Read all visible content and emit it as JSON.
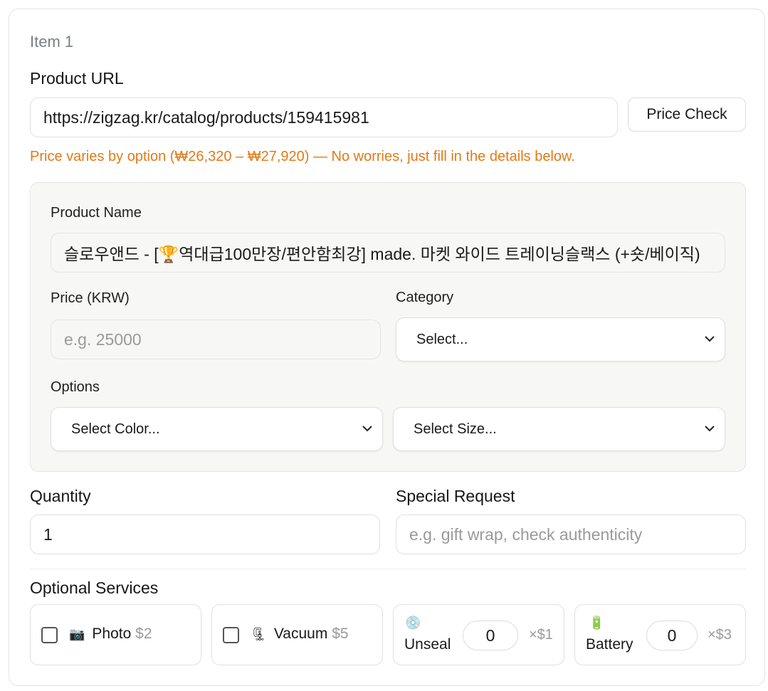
{
  "item": {
    "title": "Item 1"
  },
  "product_url": {
    "label": "Product URL",
    "value": "https://zigzag.kr/catalog/products/159415981",
    "price_check_button": "Price Check",
    "warning": "Price varies by option (₩26,320 – ₩27,920) — No worries, just fill in the details below."
  },
  "details": {
    "product_name_label": "Product Name",
    "product_name_value": "슬로우앤드 - [🏆역대급100만장/편안함최강] made. 마켓 와이드 트레이닝슬랙스 (+숏/베이직)",
    "price_label": "Price (KRW)",
    "price_placeholder": "e.g. 25000",
    "category_label": "Category",
    "category_value": "Select...",
    "options_label": "Options",
    "color_value": "Select Color...",
    "size_value": "Select Size..."
  },
  "quantity": {
    "label": "Quantity",
    "value": "1"
  },
  "special_request": {
    "label": "Special Request",
    "placeholder": "e.g. gift wrap, check authenticity"
  },
  "services": {
    "title": "Optional Services",
    "items": [
      {
        "icon": "camera-icon",
        "emoji": "📷",
        "name": "Photo",
        "price": "$2"
      },
      {
        "icon": "vacuum-icon",
        "emoji": "🗜",
        "name": "Vacuum",
        "price": "$5"
      },
      {
        "icon": "disc-icon",
        "emoji": "💿",
        "name": "Unseal",
        "count": "0",
        "rate": "×$1"
      },
      {
        "icon": "battery-icon",
        "emoji": "🔋",
        "name": "Battery",
        "count": "0",
        "rate": "×$3"
      }
    ]
  },
  "colors": {
    "warning": "#e07a17",
    "panel": "#f7f7f5",
    "muted": "#9a9a9a"
  }
}
